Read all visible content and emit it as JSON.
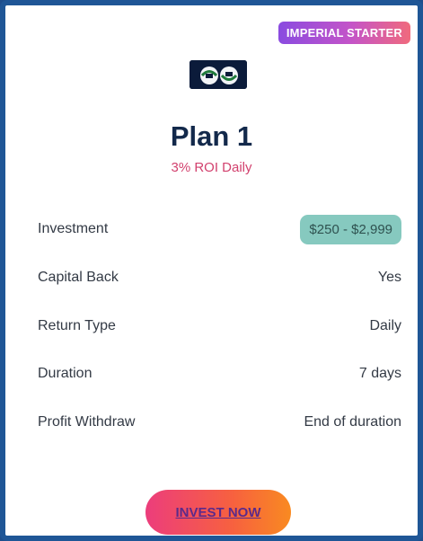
{
  "card": {
    "badge": "IMPERIAL STARTER",
    "plan_title": "Plan 1",
    "roi_text": "3% ROI Daily",
    "details": [
      {
        "label": "Investment",
        "value": "$250 - $2,999"
      },
      {
        "label": "Capital Back",
        "value": "Yes"
      },
      {
        "label": "Return Type",
        "value": "Daily"
      },
      {
        "label": "Duration",
        "value": "7 days"
      },
      {
        "label": "Profit Withdraw",
        "value": "End of duration"
      }
    ],
    "cta_label": "INVEST NOW"
  },
  "icons": {
    "logo": "brand-logo-icon"
  },
  "colors": {
    "frame_border": "#1f5696",
    "badge_gradient_start": "#8a4be0",
    "badge_gradient_end": "#f06a7d",
    "title": "#13294b",
    "roi": "#d2416e",
    "investment_pill": "#86c9bf",
    "button_gradient_start": "#ec3d7c",
    "button_gradient_end": "#f98a21"
  }
}
